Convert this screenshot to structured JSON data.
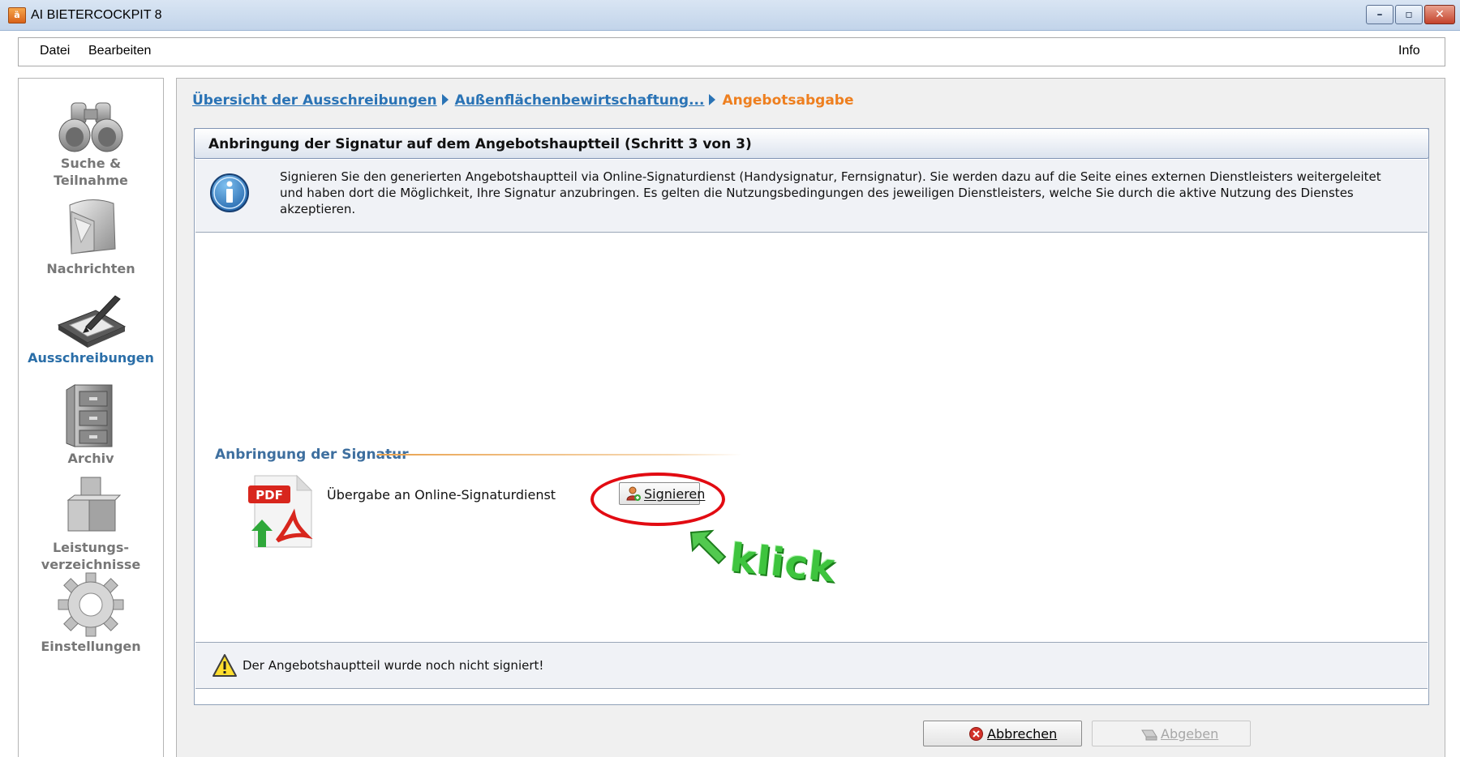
{
  "window": {
    "title": "AI BIETERCOCKPIT 8"
  },
  "menu": {
    "file": "Datei",
    "edit": "Bearbeiten",
    "info": "Info"
  },
  "nav": {
    "items": [
      {
        "label_lines": [
          "Suche &",
          "Teilnahme"
        ],
        "icon": "binoculars-icon"
      },
      {
        "label_lines": [
          "Nachrichten"
        ],
        "icon": "mailbox-icon"
      },
      {
        "label_lines": [
          "Ausschreibungen"
        ],
        "icon": "signature-tablet-icon",
        "active": true
      },
      {
        "label_lines": [
          "Archiv"
        ],
        "icon": "filing-cabinet-icon"
      },
      {
        "label_lines": [
          "Leistungs-",
          "verzeichnisse"
        ],
        "icon": "boxes-icon"
      },
      {
        "label_lines": [
          "Einstellungen"
        ],
        "icon": "gear-icon"
      }
    ]
  },
  "breadcrumb": {
    "items": [
      "Übersicht der Ausschreibungen",
      "Außenflächenbewirtschaftung..."
    ],
    "current": "Angebotsabgabe"
  },
  "panel": {
    "title": "Anbringung der Signatur auf dem Angebotshauptteil (Schritt 3 von 3)",
    "info_text": "Signieren Sie den generierten Angebotshauptteil via Online-Signaturdienst (Handysignatur, Fernsignatur). Sie werden dazu auf die Seite eines externen Dienstleisters weitergeleitet und haben dort die Möglichkeit, Ihre Signatur anzubringen. Es gelten die Nutzungsbedingungen des jeweiligen Dienstleisters, welche Sie durch die aktive Nutzung des Dienstes akzeptieren.",
    "section_title": "Anbringung der Signatur",
    "transfer_label": "Übergabe an Online-Signaturdienst",
    "sign_button": "Signieren",
    "pdf_badge": "PDF",
    "annotation": "klick",
    "status": "Der Angebotshauptteil wurde noch nicht signiert!"
  },
  "footer": {
    "cancel": "Abbrechen",
    "submit": "Abgeben"
  },
  "colors": {
    "accent_link": "#2a73b5",
    "current_step": "#ee7f1f",
    "highlight": "#e20b12",
    "annotation": "#3ec43e"
  }
}
